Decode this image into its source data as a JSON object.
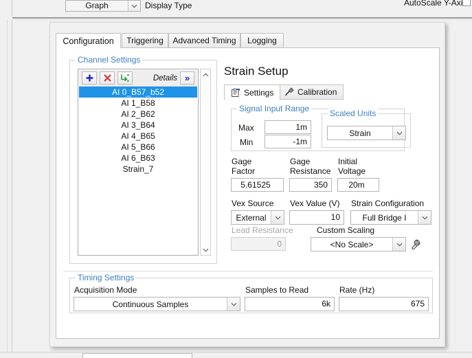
{
  "topbar": {
    "display_type_value": "Graph",
    "display_type_label": "Display Type",
    "autoscale_label": "AutoScale Y-Axis"
  },
  "tabs": [
    {
      "label": "Configuration",
      "active": true
    },
    {
      "label": "Triggering",
      "active": false
    },
    {
      "label": "Advanced Timing",
      "active": false
    },
    {
      "label": "Logging",
      "active": false
    }
  ],
  "channel_settings": {
    "group_label": "Channel Settings",
    "toolbar": {
      "add_label": "+",
      "delete_label": "✕",
      "import_label": "import-channel",
      "details_label": "Details",
      "expand_label": "»"
    },
    "channels": [
      {
        "name": "AI 0_B57_b52",
        "selected": true
      },
      {
        "name": "AI 1_B58",
        "selected": false
      },
      {
        "name": "AI 2_B62",
        "selected": false
      },
      {
        "name": "AI 3_B64",
        "selected": false
      },
      {
        "name": "AI 4_B65",
        "selected": false
      },
      {
        "name": "AI 5_B66",
        "selected": false
      },
      {
        "name": "AI 6_B63",
        "selected": false
      },
      {
        "name": "Strain_7",
        "selected": false
      }
    ]
  },
  "strain_setup": {
    "title": "Strain Setup",
    "inner_tabs": [
      {
        "label": "Settings",
        "icon": "properties-icon",
        "active": true
      },
      {
        "label": "Calibration",
        "icon": "tool-icon",
        "active": false
      }
    ],
    "signal_input_range": {
      "group_label": "Signal Input Range",
      "max_label": "Max",
      "max_value": "1m",
      "min_label": "Min",
      "min_value": "-1m"
    },
    "scaled_units": {
      "group_label": "Scaled Units",
      "value": "Strain"
    },
    "gage": {
      "factor_label": "Gage\nFactor",
      "factor_label_l1": "Gage",
      "factor_label_l2": "Factor",
      "factor_value": "5.61525",
      "resistance_label_l1": "Gage",
      "resistance_label_l2": "Resistance",
      "resistance_value": "350",
      "initial_voltage_label_l1": "Initial",
      "initial_voltage_label_l2": "Voltage",
      "initial_voltage_value": "20m"
    },
    "vex": {
      "source_label": "Vex Source",
      "source_value": "External",
      "value_label": "Vex Value (V)",
      "value_value": "10",
      "strain_config_label": "Strain Configuration",
      "strain_config_value": "Full Bridge I"
    },
    "lead_resistance": {
      "label": "Lead Resistance",
      "value": "0"
    },
    "custom_scaling": {
      "label": "Custom Scaling",
      "value": "<No Scale>",
      "edit_icon": "wrench-icon"
    }
  },
  "timing_settings": {
    "group_label": "Timing Settings",
    "acquisition_mode_label": "Acquisition Mode",
    "acquisition_mode_value": "Continuous Samples",
    "samples_to_read_label": "Samples to Read",
    "samples_to_read_value": "6k",
    "rate_label": "Rate (Hz)",
    "rate_value": "675"
  },
  "colors": {
    "selection_blue": "#1e93e8",
    "group_label_blue": "#3f7fbf",
    "add_icon_blue": "#2222cc",
    "delete_icon_red": "#d04040",
    "import_icon_green": "#2e9e3e"
  }
}
